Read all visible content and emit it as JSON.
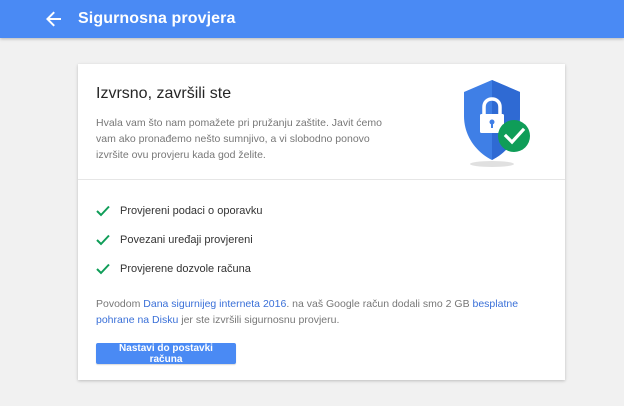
{
  "header": {
    "title": "Sigurnosna provjera",
    "back_icon": "arrow-back-icon",
    "color": "#4a8af4"
  },
  "card": {
    "title": "Izvrsno, završili ste",
    "description": "Hvala vam što nam pomažete pri pružanju zaštite. Javit ćemo vam ako pronađemo nešto sumnjivo, a vi slobodno ponovo izvršite ovu provjeru kada god želite.",
    "illustration_icon": "shield-lock-check-icon"
  },
  "checklist": [
    {
      "label": "Provjereni podaci o oporavku",
      "icon": "checkmark-icon"
    },
    {
      "label": "Povezani uređaji provjereni",
      "icon": "checkmark-icon"
    },
    {
      "label": "Provjerene dozvole računa",
      "icon": "checkmark-icon"
    }
  ],
  "promo": {
    "prefix": "Povodom ",
    "link1": "Dana sigurnijeg interneta 2016",
    "middle": ". na vaš Google račun dodali smo 2 GB ",
    "link2": "besplatne pohrane na Disku",
    "suffix": " jer ste izvršili sigurnosnu provjeru."
  },
  "button": {
    "label": "Nastavi do postavki računa"
  },
  "colors": {
    "accent": "#4a8af4",
    "check_green": "#0f9d58",
    "link": "#3a70d8"
  }
}
